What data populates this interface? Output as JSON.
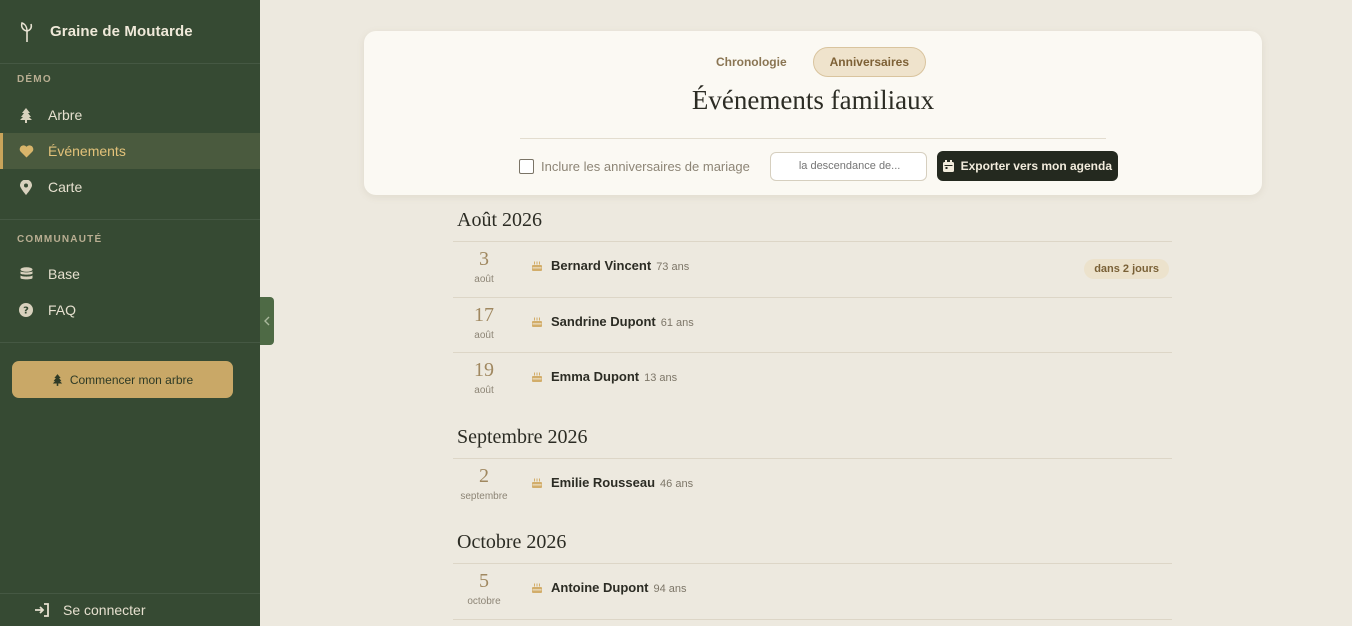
{
  "sidebar": {
    "brand": "Graine de Moutarde",
    "sections": [
      {
        "title": "DÉMO",
        "items": [
          {
            "label": "Arbre",
            "icon": "tree-icon"
          },
          {
            "label": "Événements",
            "icon": "heart-icon",
            "active": true
          },
          {
            "label": "Carte",
            "icon": "map-pin-icon"
          }
        ]
      },
      {
        "title": "COMMUNAUTÉ",
        "items": [
          {
            "label": "Base",
            "icon": "database-icon"
          },
          {
            "label": "FAQ",
            "icon": "question-icon"
          }
        ]
      }
    ],
    "cta": "Commencer mon arbre",
    "login": "Se connecter"
  },
  "header": {
    "tabs": [
      {
        "label": "Chronologie",
        "active": false
      },
      {
        "label": "Anniversaires",
        "active": true
      }
    ],
    "title": "Événements familiaux",
    "checkbox_label": "Inclure les anniversaires de mariage",
    "checkbox_checked": false,
    "search_placeholder": "la descendance de...",
    "export_label": "Exporter vers mon agenda"
  },
  "months": [
    {
      "title": "Août 2026",
      "events": [
        {
          "day": "3",
          "month": "août",
          "name": "Bernard Vincent",
          "age": "73 ans",
          "badge": "dans 2 jours"
        },
        {
          "day": "17",
          "month": "août",
          "name": "Sandrine Dupont",
          "age": "61 ans"
        },
        {
          "day": "19",
          "month": "août",
          "name": "Emma Dupont",
          "age": "13 ans"
        }
      ]
    },
    {
      "title": "Septembre 2026",
      "events": [
        {
          "day": "2",
          "month": "septembre",
          "name": "Emilie Rousseau",
          "age": "46 ans"
        }
      ]
    },
    {
      "title": "Octobre 2026",
      "events": [
        {
          "day": "5",
          "month": "octobre",
          "name": "Antoine Dupont",
          "age": "94 ans"
        }
      ]
    }
  ],
  "colors": {
    "sidebar_bg": "#364a33",
    "accent_gold": "#c9a867",
    "page_bg": "#ede9df",
    "dark_button": "#24291f"
  }
}
